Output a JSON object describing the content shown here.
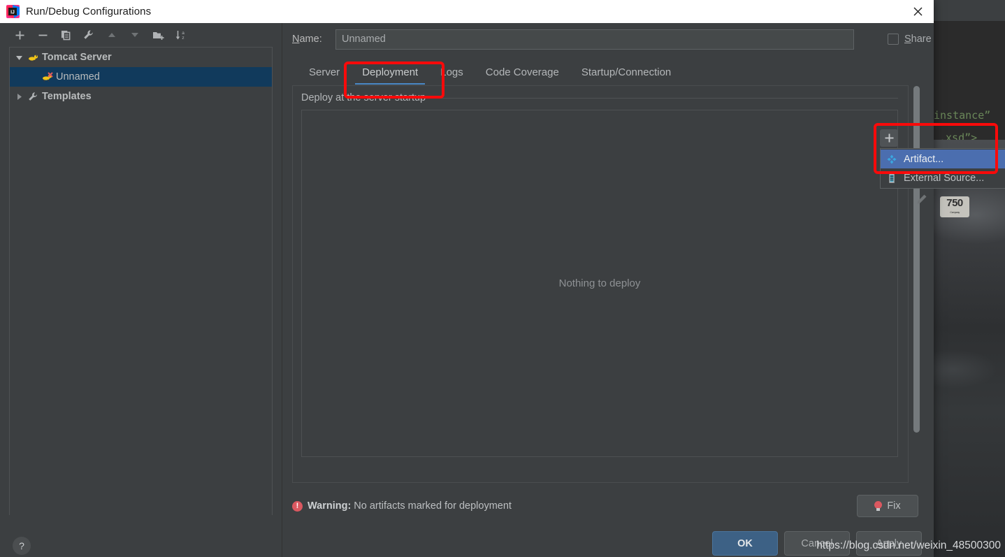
{
  "window": {
    "title": "Run/Debug Configurations",
    "logo_icon": "intellij-idea-logo-icon",
    "close_icon": "close-icon"
  },
  "left_panel": {
    "toolbar": [
      {
        "name": "add-configuration-button",
        "icon": "plus-icon",
        "glyph": "+"
      },
      {
        "name": "remove-configuration-button",
        "icon": "minus-icon",
        "glyph": "−"
      },
      {
        "name": "copy-configuration-button",
        "icon": "copy-icon",
        "glyph": "❐"
      },
      {
        "name": "edit-templates-button",
        "icon": "wrench-icon",
        "glyph": "🔧"
      },
      {
        "name": "move-up-button",
        "icon": "arrow-up-icon",
        "glyph": "▲"
      },
      {
        "name": "move-down-button",
        "icon": "arrow-down-icon",
        "glyph": "▼"
      },
      {
        "name": "create-folder-button",
        "icon": "folder-plus-icon",
        "glyph": "🗀"
      },
      {
        "name": "sort-configurations-button",
        "icon": "sort-alpha-icon",
        "glyph": "↓"
      }
    ],
    "tree": [
      {
        "label": "Tomcat Server",
        "twisty": "▼",
        "icon": "tomcat-icon",
        "selected": false,
        "level": 0
      },
      {
        "label": "Unnamed",
        "twisty": "",
        "icon": "tomcat-error-icon",
        "selected": true,
        "level": 1
      },
      {
        "label": "Templates",
        "twisty": "▶",
        "icon": "wrench-icon",
        "selected": false,
        "level": 0
      }
    ],
    "help_button": {
      "label": "?",
      "icon": "help-icon"
    }
  },
  "right_panel": {
    "name_label": "Name:",
    "name_label_mnemonic": "N",
    "name_label_rest": "ame:",
    "name_value": "Unnamed",
    "name_placeholder": "Unnamed",
    "share_label_mnemonic": "S",
    "share_label_rest": "hare",
    "share_label": "Share",
    "share_checked": false,
    "tabs": [
      {
        "label": "Server",
        "active": false
      },
      {
        "label": "Deployment",
        "active": true
      },
      {
        "label": "Logs",
        "active": false
      },
      {
        "label": "Code Coverage",
        "active": false
      },
      {
        "label": "Startup/Connection",
        "active": false
      }
    ],
    "section_label": "Deploy at the server startup",
    "empty_text": "Nothing to deploy",
    "deploy_toolbar": [
      {
        "name": "add-artifact-button",
        "icon": "plus-icon",
        "glyph": "+"
      },
      {
        "name": "move-down-button",
        "icon": "triangle-down-icon",
        "glyph": "▼"
      },
      {
        "name": "edit-button",
        "icon": "pencil-icon",
        "glyph": "✎"
      }
    ],
    "popup_menu": [
      {
        "label": "Artifact...",
        "icon": "artifact-icon",
        "highlight": true
      },
      {
        "label": "External Source...",
        "icon": "external-source-icon",
        "highlight": false
      }
    ],
    "warning": {
      "icon": "error-icon",
      "prefix": "Warning:",
      "text": "No artifacts marked for deployment",
      "fix_label": "Fix",
      "fix_icon": "lightbulb-icon"
    },
    "buttons": [
      {
        "label": "OK",
        "style": "primary",
        "mnemonic": ""
      },
      {
        "label": "Cancel",
        "style": "normal",
        "mnemonic": ""
      },
      {
        "label": "Apply",
        "style": "normal",
        "mnemonic": "A"
      }
    ],
    "button_ok": "OK",
    "button_cancel": "Cancel",
    "button_apply_mnemonic": "A",
    "button_apply_rest": "pply"
  },
  "background": {
    "code_line_1": "instance”",
    "code_line_2": ".xsd”>",
    "plate_text": "750",
    "plate_sub": "Company"
  },
  "watermark": "https://blog.csdn.net/weixin_48500300",
  "colors": {
    "accent_blue": "#4b6eaf",
    "tab_underline": "#4a88c7",
    "selection": "#113a5c",
    "annotation_red": "#fa0a0a",
    "warning_red": "#db5860",
    "panel_bg": "#3c3f41",
    "titlebar_bg": "#ffffff"
  }
}
